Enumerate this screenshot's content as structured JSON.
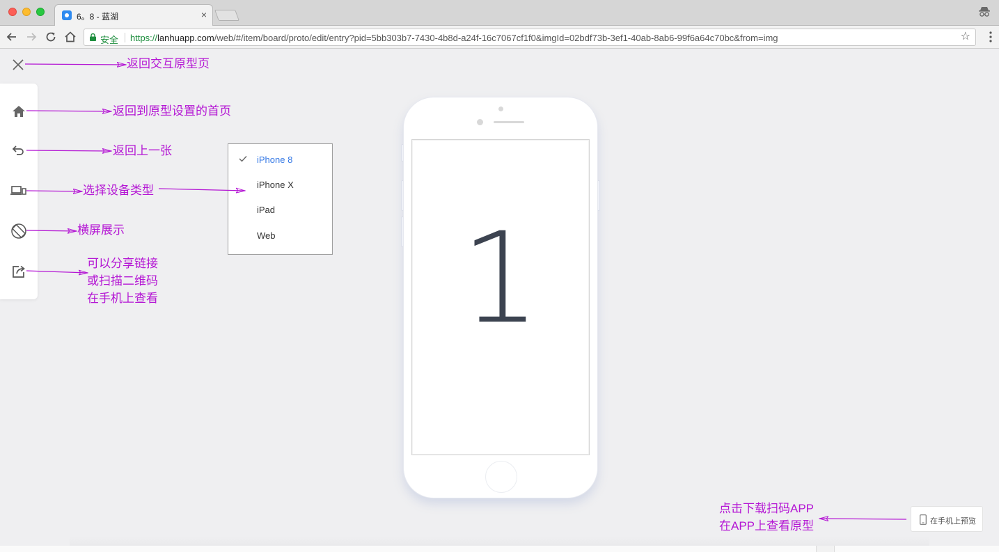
{
  "browser": {
    "tab_title": "6。8 - 蓝湖",
    "tab_close": "×",
    "secure_label": "安全",
    "url_scheme": "https://",
    "url_host": "lanhuapp.com",
    "url_path": "/web/#/item/board/proto/edit/entry?pid=5bb303b7-7430-4b8d-a24f-16c7067cf1f0&imgId=02bdf73b-3ef1-40ab-8ab6-99f6a64c70bc&from=img"
  },
  "device_menu": {
    "options": [
      {
        "label": "iPhone 8",
        "selected": true
      },
      {
        "label": "iPhone X",
        "selected": false
      },
      {
        "label": "iPad",
        "selected": false
      },
      {
        "label": "Web",
        "selected": false
      }
    ]
  },
  "phone": {
    "screen_text": "1"
  },
  "preview_button": {
    "label": "在手机上预览"
  },
  "annotations": {
    "close": "返回交互原型页",
    "home": "返回到原型设置的首页",
    "back": "返回上一张",
    "device": "选择设备类型",
    "rotate": "横屏展示",
    "share_line1": "可以分享链接",
    "share_line2": "或扫描二维码",
    "share_line3": "在手机上查看",
    "app_line1": "点击下载扫码APP",
    "app_line2": "在APP上查看原型"
  },
  "colors": {
    "annotation": "#b416d4",
    "selected_option": "#3478e5",
    "secure_green": "#1e8e3e"
  }
}
